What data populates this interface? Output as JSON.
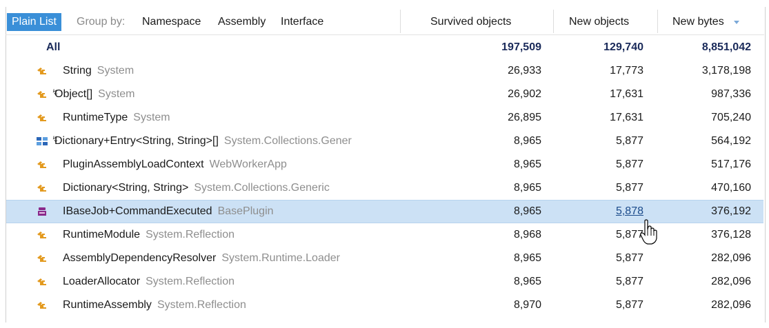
{
  "header": {
    "plain_list": "Plain List",
    "group_by": "Group by:",
    "groups": [
      "Namespace",
      "Assembly",
      "Interface"
    ],
    "columns": {
      "survived": "Survived objects",
      "new_objects": "New objects",
      "new_bytes": "New bytes"
    }
  },
  "colors": {
    "accent": "#3a8fd8",
    "selected_row": "#cce1f5",
    "type_icon": "#e39a1f",
    "struct_icon": "#2c67b8",
    "interface_icon": "#8a2a8a"
  },
  "rows": [
    {
      "name": "All",
      "ns": "",
      "survived": "197,509",
      "new_objects": "129,740",
      "new_bytes": "8,851,042",
      "icon": "none",
      "pinned": false
    },
    {
      "name": "String",
      "ns": "System",
      "survived": "26,933",
      "new_objects": "17,773",
      "new_bytes": "3,178,198",
      "icon": "class-icon",
      "pinned": false
    },
    {
      "name": "Object[]",
      "ns": "System",
      "survived": "26,902",
      "new_objects": "17,631",
      "new_bytes": "987,336",
      "icon": "class-icon",
      "pinned": true
    },
    {
      "name": "RuntimeType",
      "ns": "System",
      "survived": "26,895",
      "new_objects": "17,631",
      "new_bytes": "705,240",
      "icon": "class-icon",
      "pinned": false
    },
    {
      "name": "Dictionary+Entry<String, String>[]",
      "ns": "System.Collections.Gener",
      "survived": "8,965",
      "new_objects": "5,877",
      "new_bytes": "564,192",
      "icon": "struct-icon",
      "pinned": true
    },
    {
      "name": "PluginAssemblyLoadContext",
      "ns": "WebWorkerApp",
      "survived": "8,965",
      "new_objects": "5,877",
      "new_bytes": "517,176",
      "icon": "class-icon",
      "pinned": false
    },
    {
      "name": "Dictionary<String, String>",
      "ns": "System.Collections.Generic",
      "survived": "8,965",
      "new_objects": "5,877",
      "new_bytes": "470,160",
      "icon": "class-icon",
      "pinned": false
    },
    {
      "name": "IBaseJob+CommandExecuted",
      "ns": "BasePlugin",
      "survived": "8,965",
      "new_objects": "5,878",
      "new_bytes": "376,192",
      "icon": "interface-icon",
      "pinned": false,
      "selected": true
    },
    {
      "name": "RuntimeModule",
      "ns": "System.Reflection",
      "survived": "8,968",
      "new_objects": "5,877",
      "new_bytes": "376,128",
      "icon": "class-icon",
      "pinned": false
    },
    {
      "name": "AssemblyDependencyResolver",
      "ns": "System.Runtime.Loader",
      "survived": "8,965",
      "new_objects": "5,877",
      "new_bytes": "282,096",
      "icon": "class-icon",
      "pinned": false
    },
    {
      "name": "LoaderAllocator",
      "ns": "System.Reflection",
      "survived": "8,965",
      "new_objects": "5,877",
      "new_bytes": "282,096",
      "icon": "class-icon",
      "pinned": false
    },
    {
      "name": "RuntimeAssembly",
      "ns": "System.Reflection",
      "survived": "8,970",
      "new_objects": "5,877",
      "new_bytes": "282,096",
      "icon": "class-icon",
      "pinned": false
    }
  ]
}
